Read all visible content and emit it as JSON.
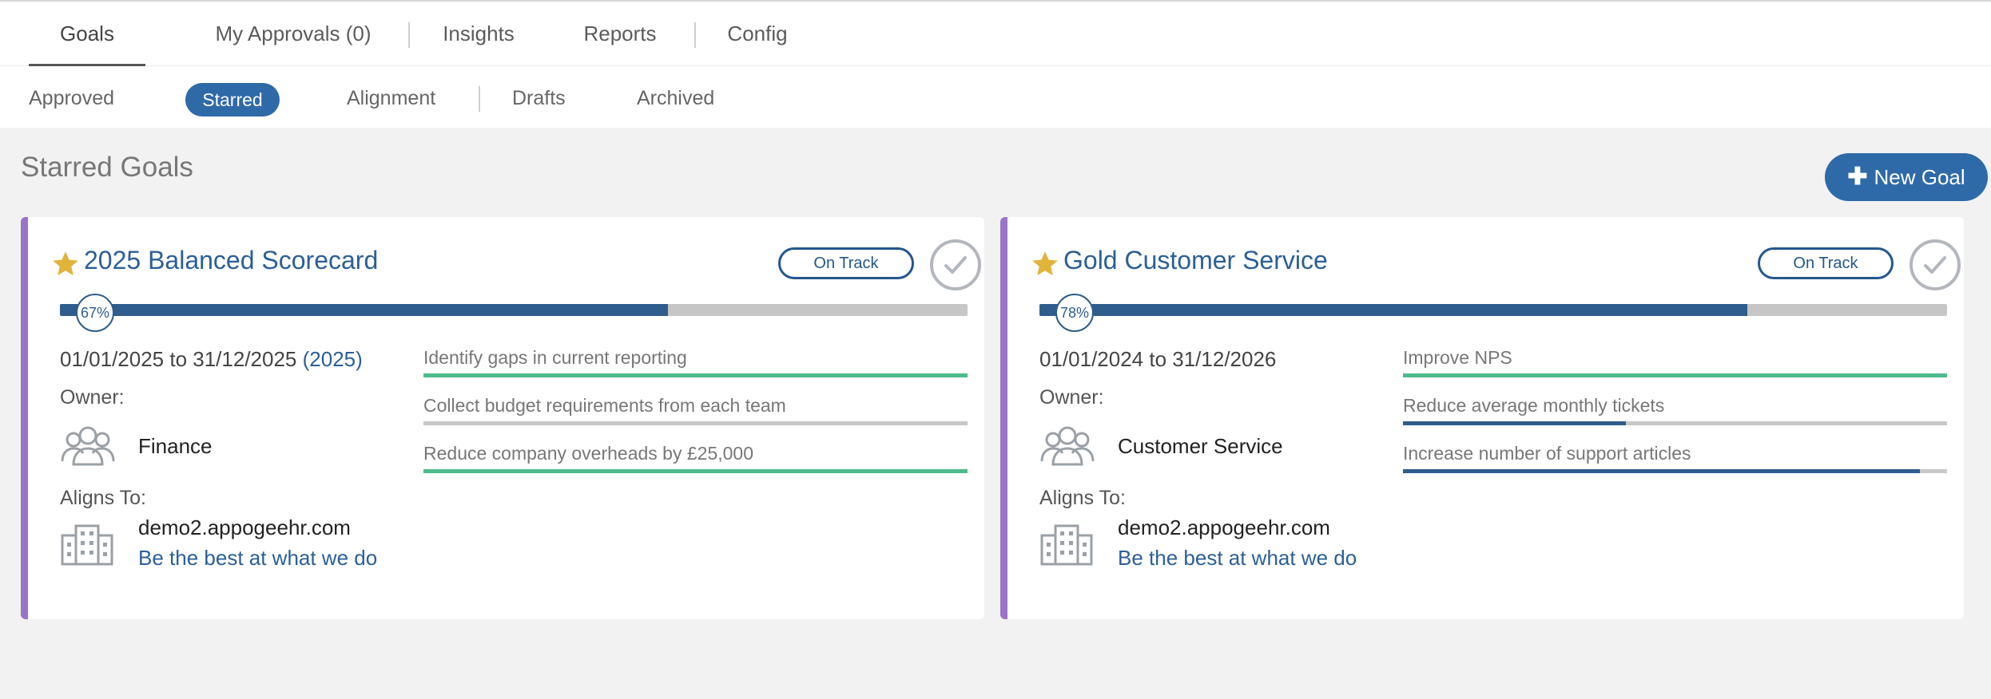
{
  "tabs_main": [
    {
      "label": "Goals",
      "active": true
    },
    {
      "label": "My Approvals (0)",
      "active": false
    },
    {
      "label": "Insights",
      "active": false
    },
    {
      "label": "Reports",
      "active": false
    },
    {
      "label": "Config",
      "active": false
    }
  ],
  "tabs_sub": [
    {
      "label": "Approved",
      "active": false
    },
    {
      "label": "Starred",
      "active": true
    },
    {
      "label": "Alignment",
      "active": false
    },
    {
      "label": "Drafts",
      "active": false
    },
    {
      "label": "Archived",
      "active": false
    }
  ],
  "page": {
    "title": "Starred Goals",
    "new_goal_label": "New Goal",
    "new_goal_icon": "plus-icon"
  },
  "colors": {
    "primary": "#2f6aa8",
    "card_accent": "#9a74c9",
    "kr_green": "#4dbb8b",
    "kr_blue": "#2e5d8d",
    "star": "#e2b33b"
  },
  "cards": [
    {
      "title": "2025 Balanced Scorecard",
      "status": "On Track",
      "progress_label": "67%",
      "progress": 0.67,
      "date_range": "01/01/2025 to 31/12/2025",
      "year_label": "(2025)",
      "owner_label": "Owner:",
      "owner": "Finance",
      "aligns_label": "Aligns To:",
      "align_org": "demo2.appogeehr.com",
      "align_goal": "Be the best at what we do",
      "key_results": [
        {
          "label": "Identify gaps in current reporting",
          "progress": 1.0,
          "color": "#4dbb8b"
        },
        {
          "label": "Collect budget requirements from each team",
          "progress": 0.0,
          "color": "#4dbb8b"
        },
        {
          "label": "Reduce company overheads by £25,000",
          "progress": 1.0,
          "color": "#4dbb8b"
        }
      ]
    },
    {
      "title": "Gold Customer Service",
      "status": "On Track",
      "progress_label": "78%",
      "progress": 0.78,
      "date_range": "01/01/2024 to 31/12/2026",
      "year_label": "",
      "owner_label": "Owner:",
      "owner": "Customer Service",
      "aligns_label": "Aligns To:",
      "align_org": "demo2.appogeehr.com",
      "align_goal": "Be the best at what we do",
      "key_results": [
        {
          "label": "Improve NPS",
          "progress": 1.0,
          "color": "#4dbb8b"
        },
        {
          "label": "Reduce average monthly tickets",
          "progress": 0.41,
          "color": "#2e5d8d"
        },
        {
          "label": "Increase number of support articles",
          "progress": 0.95,
          "color": "#2e5d8d"
        }
      ]
    }
  ]
}
